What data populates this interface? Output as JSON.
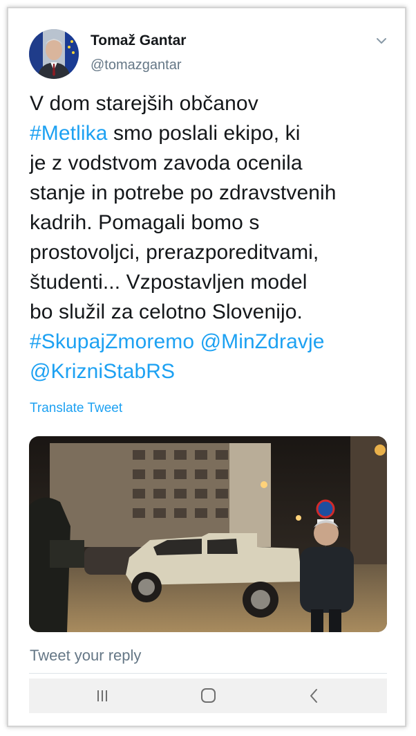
{
  "author": {
    "name": "Tomaž Gantar",
    "handle": "@tomazgantar"
  },
  "tweet": {
    "lines": [
      [
        {
          "text": "V dom starejših občanov"
        }
      ],
      [
        {
          "text": "#Metlika",
          "link": true
        },
        {
          "text": " smo poslali ekipo, ki"
        }
      ],
      [
        {
          "text": "je z vodstvom zavoda ocenila"
        }
      ],
      [
        {
          "text": "stanje in potrebe po zdravstvenih"
        }
      ],
      [
        {
          "text": "kadrih. Pomagali bomo s"
        }
      ],
      [
        {
          "text": "prostovoljci, prerazporeditvami,"
        }
      ],
      [
        {
          "text": "študenti... Vzpostavljen model"
        }
      ],
      [
        {
          "text": "bo služil za celotno Slovenijo."
        }
      ],
      [
        {
          "text": "#SkupajZmoremo",
          "link": true
        },
        {
          "text": " "
        },
        {
          "text": "@MinZdravje",
          "link": true
        }
      ],
      [
        {
          "text": "@KrizniStabRS",
          "link": true
        }
      ]
    ],
    "translate_label": "Translate Tweet"
  },
  "reply": {
    "placeholder": "Tweet your reply"
  },
  "icons": {
    "caret": "chevron-down-icon",
    "recents": "recent-apps-icon",
    "home": "home-icon",
    "back": "back-icon"
  },
  "colors": {
    "link": "#1da1f2",
    "text": "#14171a",
    "secondary": "#657786"
  }
}
